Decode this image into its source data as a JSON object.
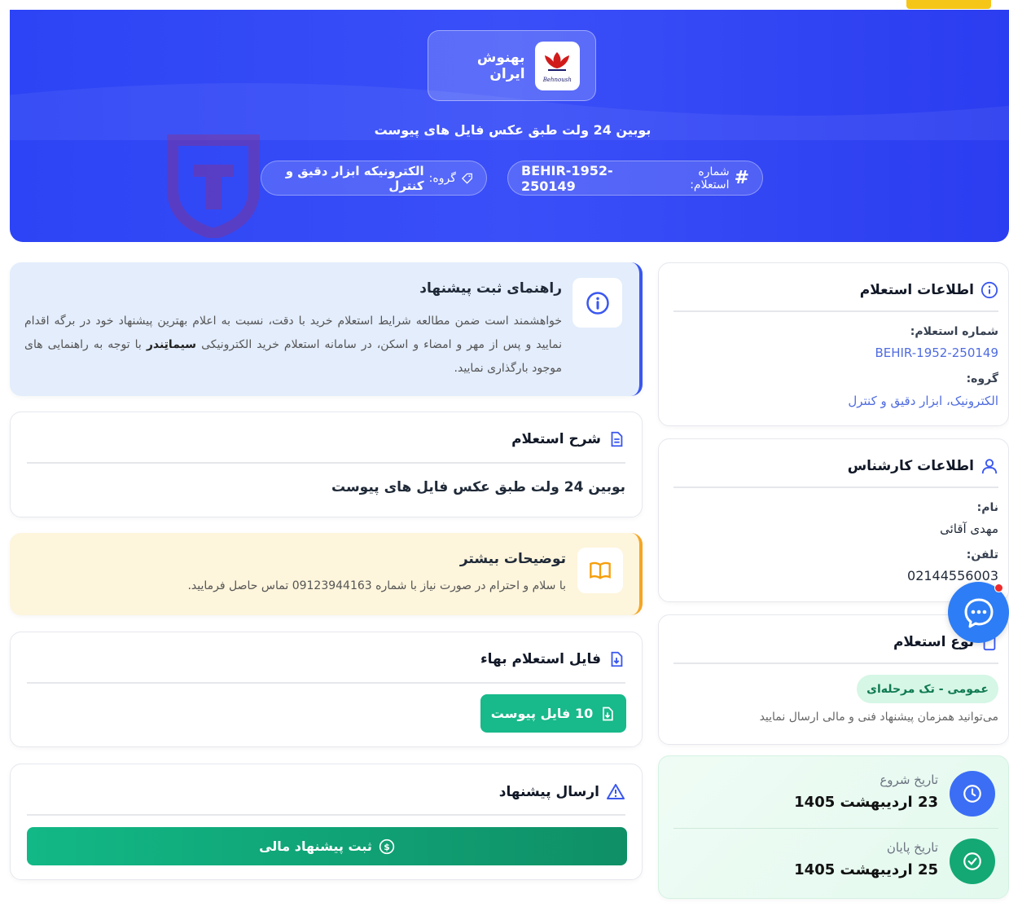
{
  "company": {
    "name": "بهنوش ایران",
    "logo_caption": "Behnoush"
  },
  "hero": {
    "title": "بوبین 24 ولت طبق عکس فایل های پیوست",
    "number_label": "شماره استعلام:",
    "number_value": "BEHIR-1952-250149",
    "group_label": "گروه:",
    "group_value": "الکترونیکه ابزار دقیق و کنترل"
  },
  "guide": {
    "title": "راهنمای ثبت پیشنهاد",
    "line1": "خواهشمند است ضمن مطالعه شرایط استعلام خرید با دقت، نسبت به اعلام بهترین پیشنهاد خود در برگه",
    "line2_a": "اقدام نمایید و پس از مهر و امضاء و اسکن، در سامانه استعلام خرید الکترونیکی",
    "line2_brand": "سیماتِندر",
    "line2_b": "با توجه به",
    "line3": "راهنمایی های موجود بارگذاری نمایید."
  },
  "description": {
    "title": "شرح استعلام",
    "text": "بوبین 24 ولت طبق عکس فایل های پیوست"
  },
  "more": {
    "title": "توضیحات بیشتر",
    "text": "با سلام و احترام در صورت نیاز با شماره 09123944163 تماس حاصل فرمایید."
  },
  "file": {
    "title": "فایل استعلام بهاء",
    "button": "10 فایل پیوست"
  },
  "submit": {
    "title": "ارسال پیشنهاد",
    "button": "ثبت پیشنهاد مالی"
  },
  "inquiry_info": {
    "title": "اطلاعات استعلام",
    "number_label": "شماره استعلام:",
    "number_value": "BEHIR-1952-250149",
    "group_label": "گروه:",
    "group_value": "الکترونیک، ابزار دقیق و کنترل"
  },
  "expert": {
    "title": "اطلاعات کارشناس",
    "name_label": "نام:",
    "name_value": "مهدی آقائی",
    "phone_label": "تلفن:",
    "phone_value": "02144556003"
  },
  "type": {
    "title": "نوع استعلام",
    "badge": "عمومی - تک مرحله‌ای",
    "note": "می‌توانید همزمان پیشنهاد فنی و مالی ارسال نمایید"
  },
  "dates": {
    "start_label": "تاریخ شروع",
    "start_value": "23 اردیبهشت 1405",
    "end_label": "تاریخ پایان",
    "end_value": "25 اردیبهشت 1405"
  },
  "colors": {
    "primary": "#2c44f5",
    "green": "#18b98a",
    "amber": "#f5a524"
  }
}
